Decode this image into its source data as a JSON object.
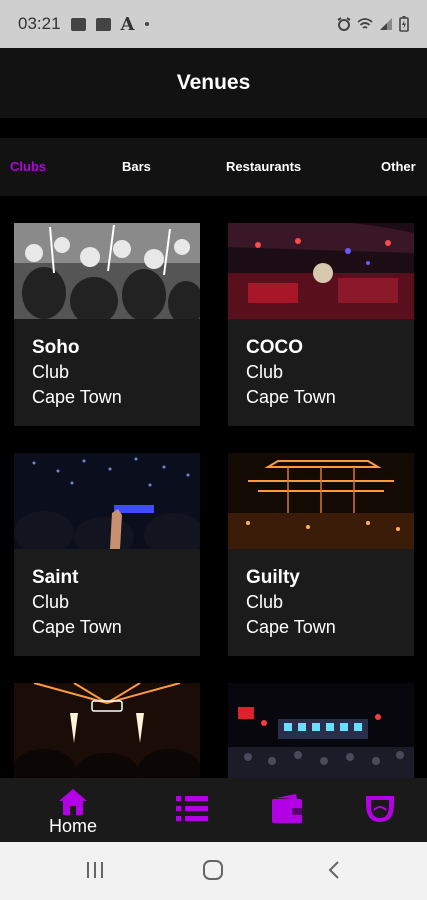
{
  "status_bar": {
    "time": "03:21",
    "letter": "A"
  },
  "app_bar": {
    "title": "Venues"
  },
  "tabs": [
    {
      "label": "Clubs",
      "active": true
    },
    {
      "label": "Bars",
      "active": false
    },
    {
      "label": "Restaurants",
      "active": false
    },
    {
      "label": "Other",
      "active": false
    }
  ],
  "venues": [
    {
      "name": "Soho",
      "type": "Club",
      "city": "Cape Town",
      "photo": "bw-crowd-sparklers"
    },
    {
      "name": "COCO",
      "type": "Club",
      "city": "Cape Town",
      "photo": "red-lounge"
    },
    {
      "name": "Saint",
      "type": "Club",
      "city": "Cape Town",
      "photo": "dark-crowd-blue-lights"
    },
    {
      "name": "Guilty",
      "type": "Club",
      "city": "Cape Town",
      "photo": "orange-ceiling-lights"
    },
    {
      "name": "",
      "type": "",
      "city": "",
      "photo": "stage-sparklers-crowd"
    },
    {
      "name": "",
      "type": "",
      "city": "",
      "photo": "outdoor-stage-crowd"
    }
  ],
  "bottom_nav": {
    "home_label": "Home",
    "accent_color": "#b400e6"
  },
  "colors": {
    "background": "#000000",
    "card": "#1b1b1b",
    "accent": "#b400e6",
    "bar": "#121212"
  }
}
